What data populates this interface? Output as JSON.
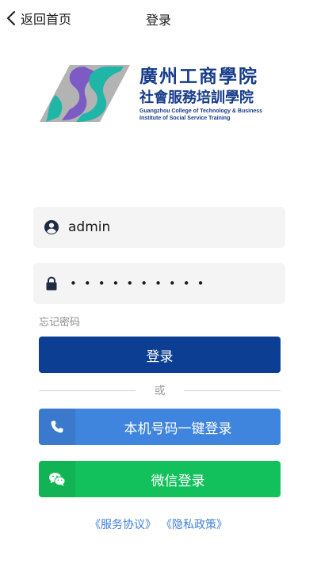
{
  "header": {
    "back_label": "返回首页",
    "title": "登录"
  },
  "logo": {
    "name_line_1": "廣州工商學院",
    "name_line_2": "社會服務培訓學院",
    "english_line_1": "Guangzhou College of Technology & Business",
    "english_line_2": "Institute of Social Service Training",
    "colors": {
      "teal": "#1fb6a7",
      "purple": "#7c5cc4",
      "gray": "#b3b3b3",
      "navy": "#173c8a"
    }
  },
  "form": {
    "username": {
      "icon": "user-circle-icon",
      "value": "admin"
    },
    "password": {
      "icon": "lock-icon",
      "masked_value": "••••••••••"
    },
    "forgot_label": "忘记密码"
  },
  "buttons": {
    "login_label": "登录",
    "divider_label": "或",
    "phone_login_label": "本机号码一键登录",
    "phone_icon": "phone-icon",
    "wechat_login_label": "微信登录",
    "wechat_icon": "wechat-icon"
  },
  "policy": {
    "service_agreement": "《服务协议》",
    "privacy_policy": "《隐私政策》"
  },
  "colors": {
    "login_button": "#0c3f93",
    "phone_button": "#3f84dd",
    "wechat_button": "#13c15c",
    "link": "#3f7fd8",
    "field_background": "#f4f4f4"
  }
}
